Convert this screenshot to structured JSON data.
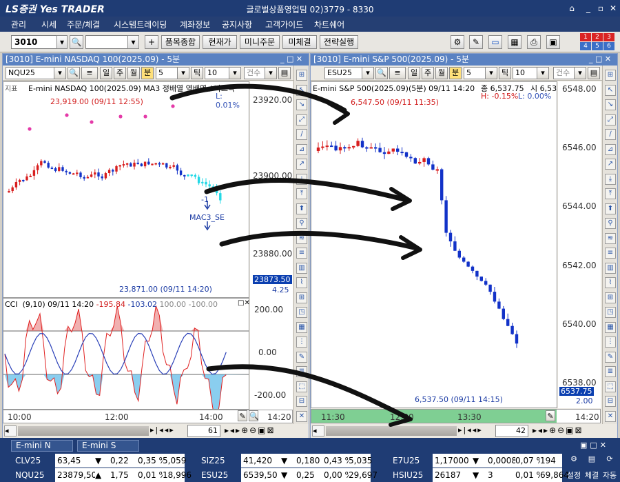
{
  "app": {
    "logo_text": "LS증권 Yes TRADER",
    "window_title": "글로벌상품영업팀 02)3779 - 8330",
    "menu": [
      "관리",
      "시세",
      "주문/체결",
      "시스템트레이딩",
      "계좌정보",
      "공지사항",
      "고객가이드",
      "차트쉐어"
    ]
  },
  "toolbar": {
    "screen_no": "3010",
    "buttons": [
      "품목종합",
      "현재가",
      "미니주문",
      "미체결",
      "전략실행"
    ],
    "red_badges": [
      "1",
      "2",
      "3",
      "4",
      "5",
      "6"
    ]
  },
  "left": {
    "title": "[3010] E-mini NASDAQ 100(2025.09) - 5분",
    "symbol": "NQU25",
    "periods": [
      "일",
      "주",
      "월",
      "분"
    ],
    "interval": "5",
    "tick_label": "틱",
    "tick_value": "10",
    "count_label": "건수",
    "legend": "E-mini NASDAQ 100(2025.09) MA3 정배열 역배열 / 나스닥",
    "legend_corner": "L: 0.01%",
    "corner_label": "지표",
    "annot_high": "23,919.00 (09/11 12:55)",
    "annot_low": "23,871.00 (09/11 14:20)",
    "signal_label": "MAC3_SE",
    "signal_count": "-1",
    "price_ticks": [
      "23920.00",
      "23900.00",
      "23880.00"
    ],
    "price_tag": "23873.50",
    "price_tag_sub": "4.25",
    "cci_header": [
      "CCI",
      "(9,10) 09/11 14:20",
      "-195.84",
      "-103.02",
      "100.00",
      "-100.00"
    ],
    "cci_ticks": [
      "200.00",
      "0.00",
      "-200.00"
    ],
    "time_labels": [
      "10:00",
      "12:00",
      "14:00"
    ],
    "time_corner": "14:20",
    "page_count": "61"
  },
  "right": {
    "title": "[3010] E-mini S&P 500(2025.09) - 5분",
    "symbol": "ESU25",
    "periods": [
      "일",
      "주",
      "월",
      "분"
    ],
    "interval": "5",
    "tick_label": "틱",
    "tick_value": "10",
    "count_label": "건수",
    "legend": "E-mini S&P 500(2025.09)(5분) 09/11 14:20",
    "close_text": "종 6,537.75",
    "open_text": "시 6,53",
    "high_pct": "H: -0.15%",
    "low_pct": "L: 0.00%",
    "annot_high": "6,547.50 (09/11 11:35)",
    "annot_low": "6,537.50 (09/11 14:15)",
    "price_ticks": [
      "6548.00",
      "6546.00",
      "6544.00",
      "6542.00",
      "6540.00",
      "6538.00"
    ],
    "price_tag": "6537.75",
    "price_tag_sub": "2.00",
    "time_labels": [
      "11:30",
      "12:30",
      "13:30"
    ],
    "time_corner": "14:20",
    "page_count": "42"
  },
  "bottom_tabs": [
    "E-mini N",
    "E-mini S"
  ],
  "quotes": [
    [
      {
        "code": "CLV25",
        "price": "63,45",
        "dir": "▼",
        "chg": "0,22",
        "pct": "0,35 %",
        "vol": "5,059"
      },
      {
        "code": "SIZ25",
        "price": "41,420",
        "dir": "▼",
        "chg": "0,180",
        "pct": "0,43 %",
        "vol": "5,035"
      },
      {
        "code": "E7U25",
        "price": "1,17000",
        "dir": "▼",
        "chg": "0,00085",
        "pct": "0,07 %",
        "vol": "194"
      }
    ],
    [
      {
        "code": "NQU25",
        "price": "23879,50",
        "dir": "▲",
        "chg": "1,75",
        "pct": "0,01 %",
        "vol": "18,996"
      },
      {
        "code": "ESU25",
        "price": "6539,50",
        "dir": "▼",
        "chg": "0,25",
        "pct": "0,00 %",
        "vol": "29,697"
      },
      {
        "code": "HSIU25",
        "price": "26187",
        "dir": "▼",
        "chg": "3",
        "pct": "0,01 %",
        "vol": "69,864"
      }
    ]
  ],
  "side_buttons": [
    "설정",
    "체결",
    "자동"
  ],
  "colors": {
    "up": "#d81e1e",
    "down": "#1232c8",
    "cci_fill": "#58b9e8",
    "signal": "#22d8e6",
    "marker": "#e43aa8"
  }
}
